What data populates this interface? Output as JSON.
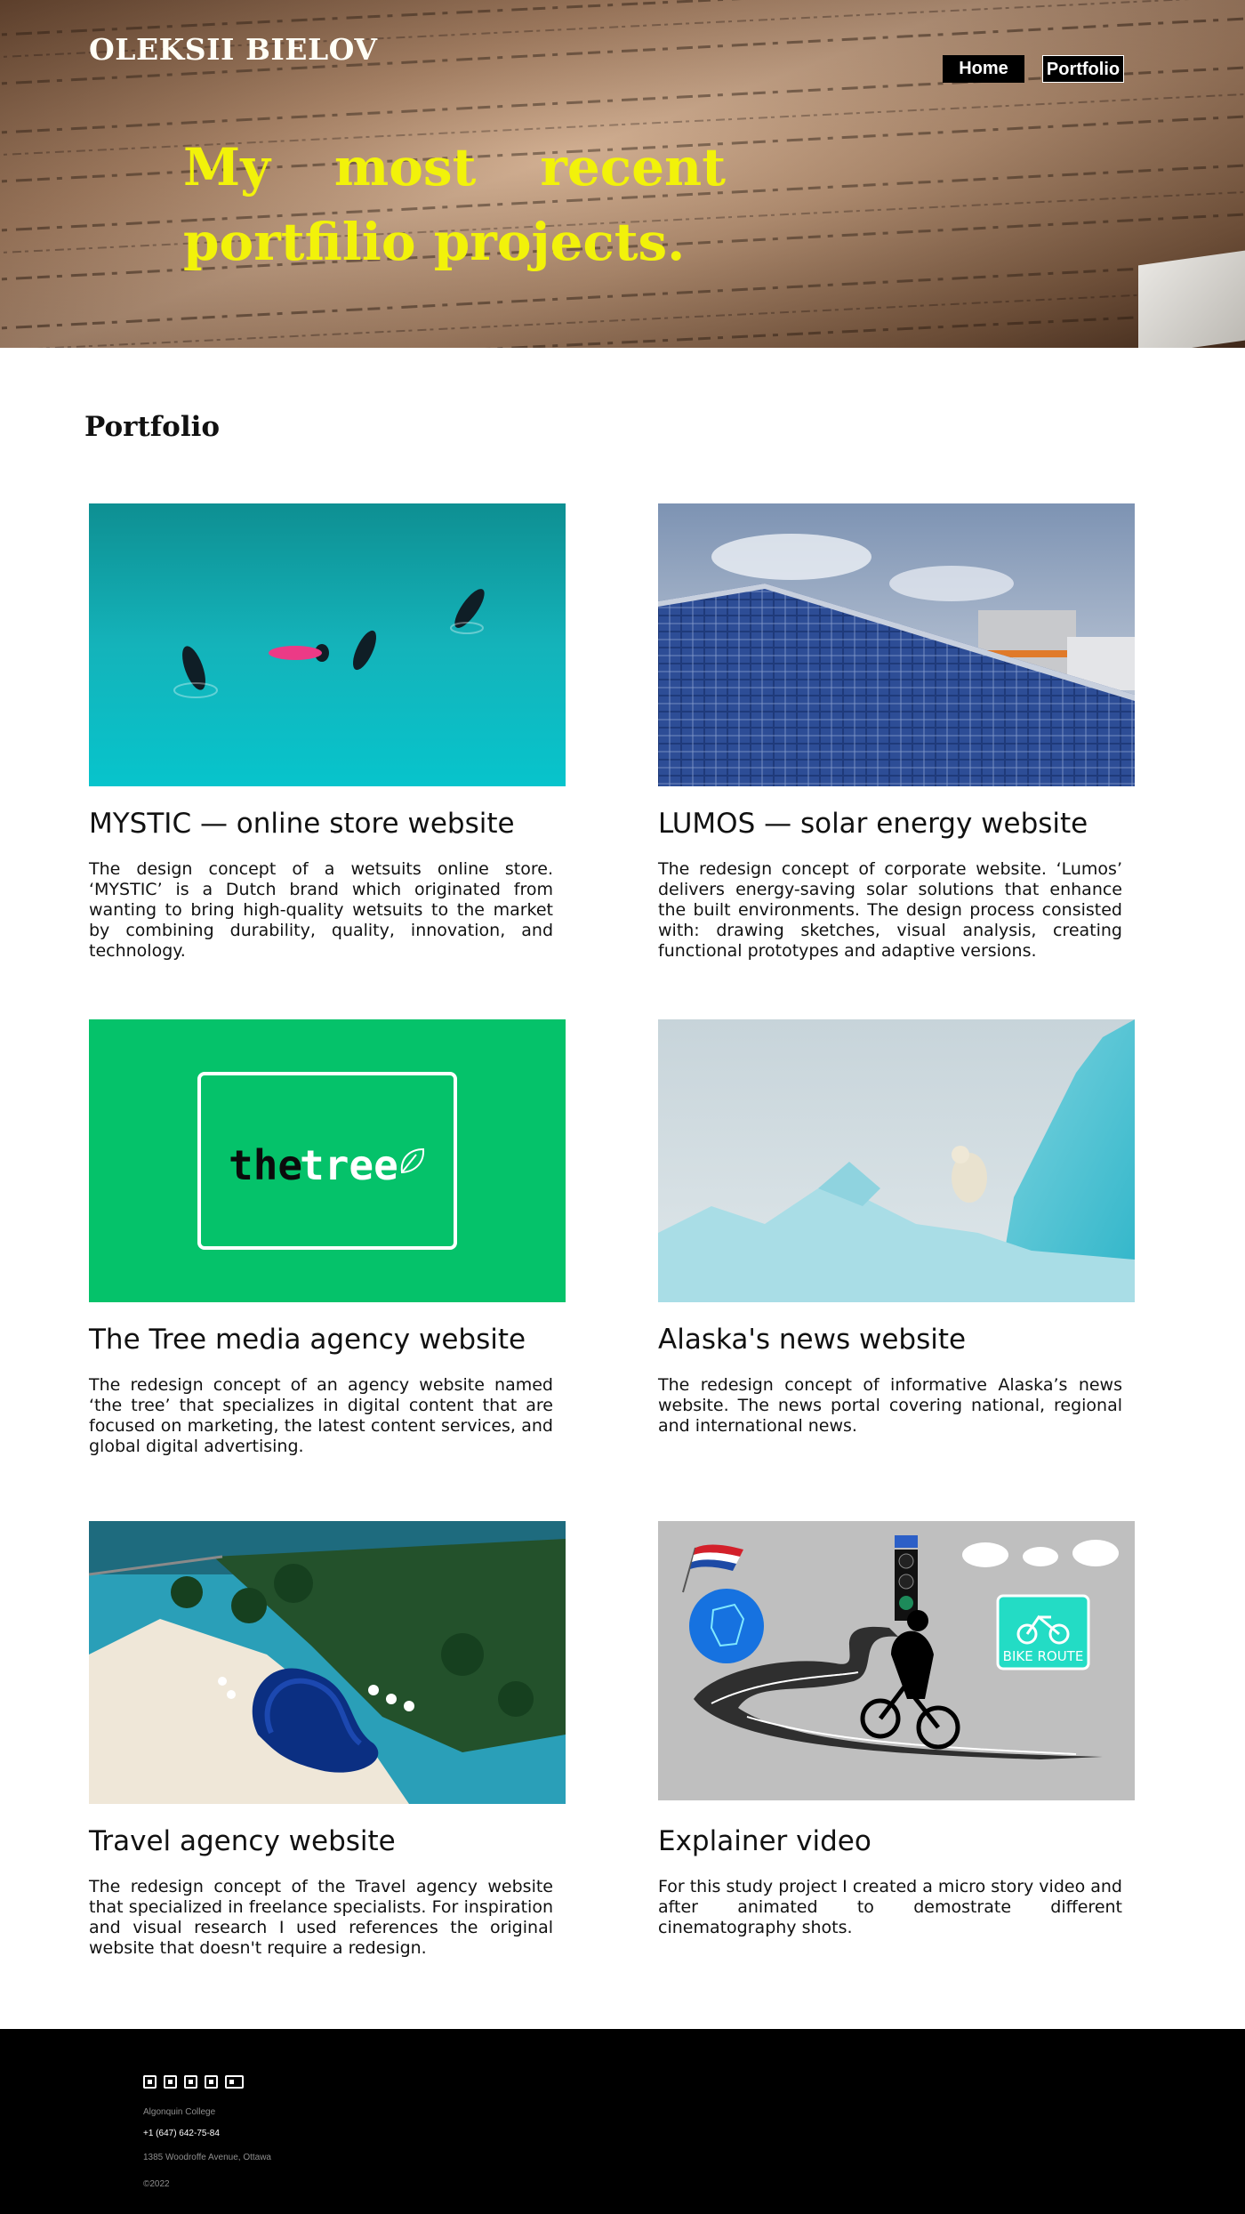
{
  "header": {
    "brand": "OLEKSII BIELOV",
    "nav": [
      {
        "label": "Home"
      },
      {
        "label": "Portfolio"
      }
    ],
    "hero_title": "My most recent portfilio projects."
  },
  "portfolio": {
    "section_title": "Portfolio",
    "items": [
      {
        "title": "MYSTIC — online store website",
        "description": "The design concept of a wetsuits online store. ‘MYSTIC’ is a Dutch brand which originated from wanting to bring high-quality wetsuits to the market by combining durability, quality, innovation, and technology."
      },
      {
        "title": "LUMOS — solar energy website",
        "description": "The redesign concept of corporate website. ‘Lumos’ delivers energy-saving solar solutions that enhance the built environments. The design process consisted with: drawing sketches, visual analysis, creating functional prototypes and adaptive versions."
      },
      {
        "title": "The Tree media agency website",
        "description": "The redesign concept of an agency website named ‘the tree’ that specializes in digital content that are focused on marketing, the latest content services, and global digital advertising.",
        "logo_word_1": "the",
        "logo_word_2": "tree"
      },
      {
        "title": "Alaska's news website",
        "description": "The redesign concept of informative Alaska’s news website. The news portal covering national, regional and international news."
      },
      {
        "title": "Travel agency website",
        "description": "The redesign concept of the Travel agency website that specialized in freelance specialists. For inspiration and visual research I used references the original website that doesn't require a redesign."
      },
      {
        "title": "Explainer video",
        "description": "For this study project I created a micro story video and after animated to demostrate different cinematography shots.",
        "sign_text": "BIKE ROUTE"
      }
    ]
  },
  "footer": {
    "social_icons": [
      "twitter-icon",
      "youtube-icon",
      "facebook-icon",
      "instagram-icon",
      "google-plus-icon"
    ],
    "school": "Algonquin College",
    "phone": "+1 (647) 642-75-84",
    "address": "1385 Woodroffe Avenue, Ottawa",
    "copyright": "©2022"
  },
  "colors": {
    "hero_title": "#f2f20a",
    "tree_green": "#05c26a",
    "ocean": "#14b3ba",
    "footer_bg": "#000000"
  }
}
